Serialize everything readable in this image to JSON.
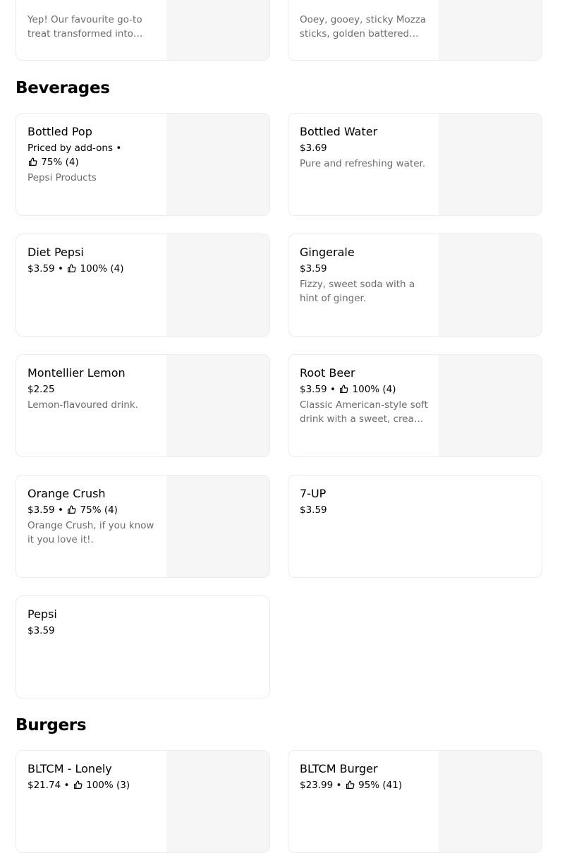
{
  "top_items": [
    {
      "description": "Yep! Our favourite go-to treat transformed into deep fried goodness."
    },
    {
      "description": "Ooey, gooey, sticky Mozza sticks, golden battered and fried."
    }
  ],
  "beverages": {
    "title": "Beverages",
    "items": [
      {
        "name": "Bottled Pop",
        "price": "Priced by add-ons",
        "rating": "75% (4)",
        "description": "Pepsi Products"
      },
      {
        "name": "Bottled Water",
        "price": "$3.69",
        "rating": "",
        "description": "Pure and refreshing water."
      },
      {
        "name": "Diet Pepsi",
        "price": "$3.59",
        "rating": "100% (4)",
        "description": ""
      },
      {
        "name": "Gingerale",
        "price": "$3.59",
        "rating": "",
        "description": "Fizzy, sweet soda with a hint of ginger."
      },
      {
        "name": "Montellier Lemon",
        "price": "$2.25",
        "rating": "",
        "description": "Lemon-flavoured drink."
      },
      {
        "name": "Root Beer",
        "price": "$3.59",
        "rating": "100% (4)",
        "description": "Classic American-style soft drink with a sweet, creamy flavour."
      },
      {
        "name": "Orange Crush",
        "price": "$3.59",
        "rating": "75% (4)",
        "description": "Orange Crush, if you know it you love it!."
      },
      {
        "name": "7-UP",
        "price": "$3.59",
        "rating": "",
        "description": ""
      },
      {
        "name": "Pepsi",
        "price": "$3.59",
        "rating": "",
        "description": ""
      }
    ]
  },
  "burgers": {
    "title": "Burgers",
    "items": [
      {
        "name": "BLTCM - Lonely",
        "price": "$21.74",
        "rating": "100% (3)"
      },
      {
        "name": "BLTCM Burger",
        "price": "$23.99",
        "rating": "95% (41)"
      }
    ]
  },
  "separator": "•",
  "icons": {
    "rating": "thumbs-up-icon"
  }
}
